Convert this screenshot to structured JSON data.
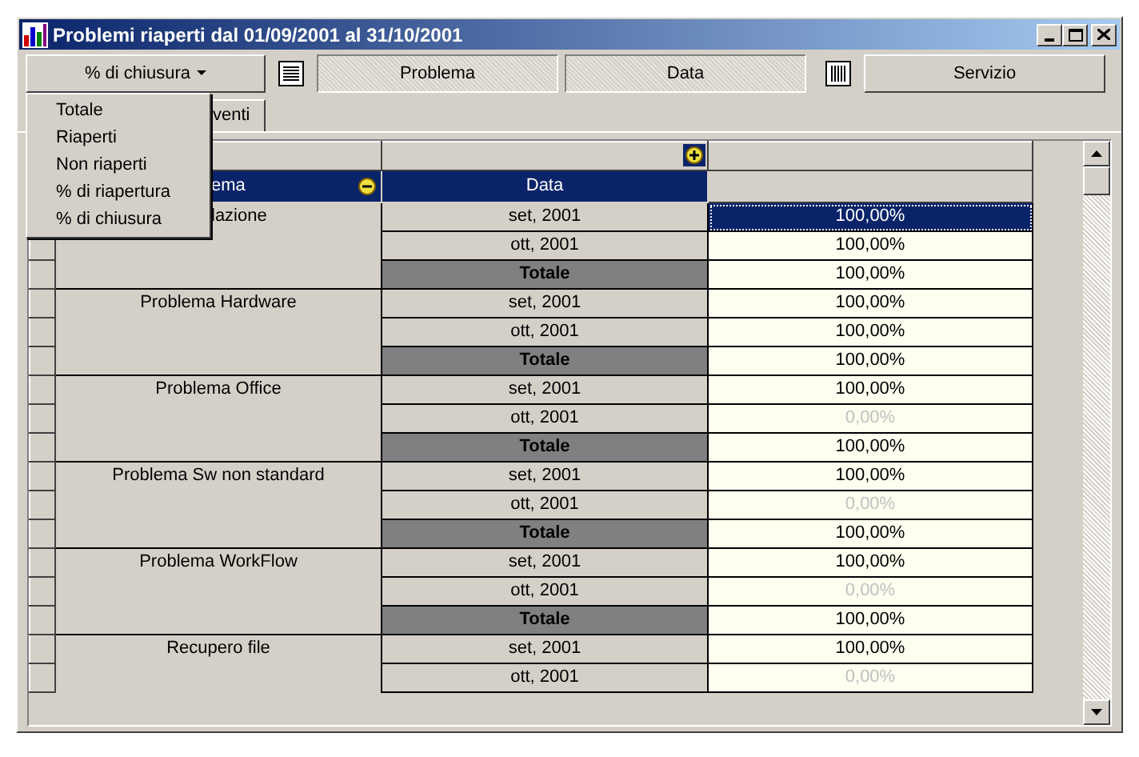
{
  "window": {
    "title": "Problemi riaperti dal 01/09/2001 al 31/10/2001"
  },
  "toolbar": [
    {
      "kind": "dropdown",
      "label": "% di chiusura"
    },
    {
      "kind": "rows-icon"
    },
    {
      "kind": "field",
      "label": "Problema",
      "pressed": true
    },
    {
      "kind": "field",
      "label": "Data",
      "pressed": true
    },
    {
      "kind": "columns-icon"
    },
    {
      "kind": "field",
      "label": "Servizio",
      "pressed": false
    }
  ],
  "tabs": [
    {
      "label": "venti",
      "selected": true
    }
  ],
  "columns": [
    "ema",
    "Data"
  ],
  "menu": {
    "items": [
      "Totale",
      "Riaperti",
      "Non riaperti",
      "% di riapertura",
      "% di chiusura"
    ]
  },
  "groups": [
    {
      "name": "lazione",
      "rows": [
        {
          "kind": "period",
          "label": "set, 2001",
          "value": "100,00%",
          "dimmed": false,
          "selected": true
        },
        {
          "kind": "period",
          "label": "ott, 2001",
          "value": "100,00%",
          "dimmed": false,
          "selected": false
        },
        {
          "kind": "total",
          "label": "Totale",
          "value": "100,00%",
          "dimmed": false,
          "selected": false
        }
      ]
    },
    {
      "name": "Problema Hardware",
      "rows": [
        {
          "kind": "period",
          "label": "set, 2001",
          "value": "100,00%",
          "dimmed": false,
          "selected": false
        },
        {
          "kind": "period",
          "label": "ott, 2001",
          "value": "100,00%",
          "dimmed": false,
          "selected": false
        },
        {
          "kind": "total",
          "label": "Totale",
          "value": "100,00%",
          "dimmed": false,
          "selected": false
        }
      ]
    },
    {
      "name": "Problema Office",
      "rows": [
        {
          "kind": "period",
          "label": "set, 2001",
          "value": "100,00%",
          "dimmed": false,
          "selected": false
        },
        {
          "kind": "period",
          "label": "ott, 2001",
          "value": "0,00%",
          "dimmed": true,
          "selected": false
        },
        {
          "kind": "total",
          "label": "Totale",
          "value": "100,00%",
          "dimmed": false,
          "selected": false
        }
      ]
    },
    {
      "name": "Problema Sw non standard",
      "rows": [
        {
          "kind": "period",
          "label": "set, 2001",
          "value": "100,00%",
          "dimmed": false,
          "selected": false
        },
        {
          "kind": "period",
          "label": "ott, 2001",
          "value": "0,00%",
          "dimmed": true,
          "selected": false
        },
        {
          "kind": "total",
          "label": "Totale",
          "value": "100,00%",
          "dimmed": false,
          "selected": false
        }
      ]
    },
    {
      "name": "Problema WorkFlow",
      "rows": [
        {
          "kind": "period",
          "label": "set, 2001",
          "value": "100,00%",
          "dimmed": false,
          "selected": false
        },
        {
          "kind": "period",
          "label": "ott, 2001",
          "value": "0,00%",
          "dimmed": true,
          "selected": false
        },
        {
          "kind": "total",
          "label": "Totale",
          "value": "100,00%",
          "dimmed": false,
          "selected": false
        }
      ]
    },
    {
      "name": "Recupero file",
      "rows": [
        {
          "kind": "period",
          "label": "set, 2001",
          "value": "100,00%",
          "dimmed": false,
          "selected": false
        },
        {
          "kind": "period",
          "label": "ott, 2001",
          "value": "0,00%",
          "dimmed": true,
          "selected": false
        }
      ]
    }
  ]
}
